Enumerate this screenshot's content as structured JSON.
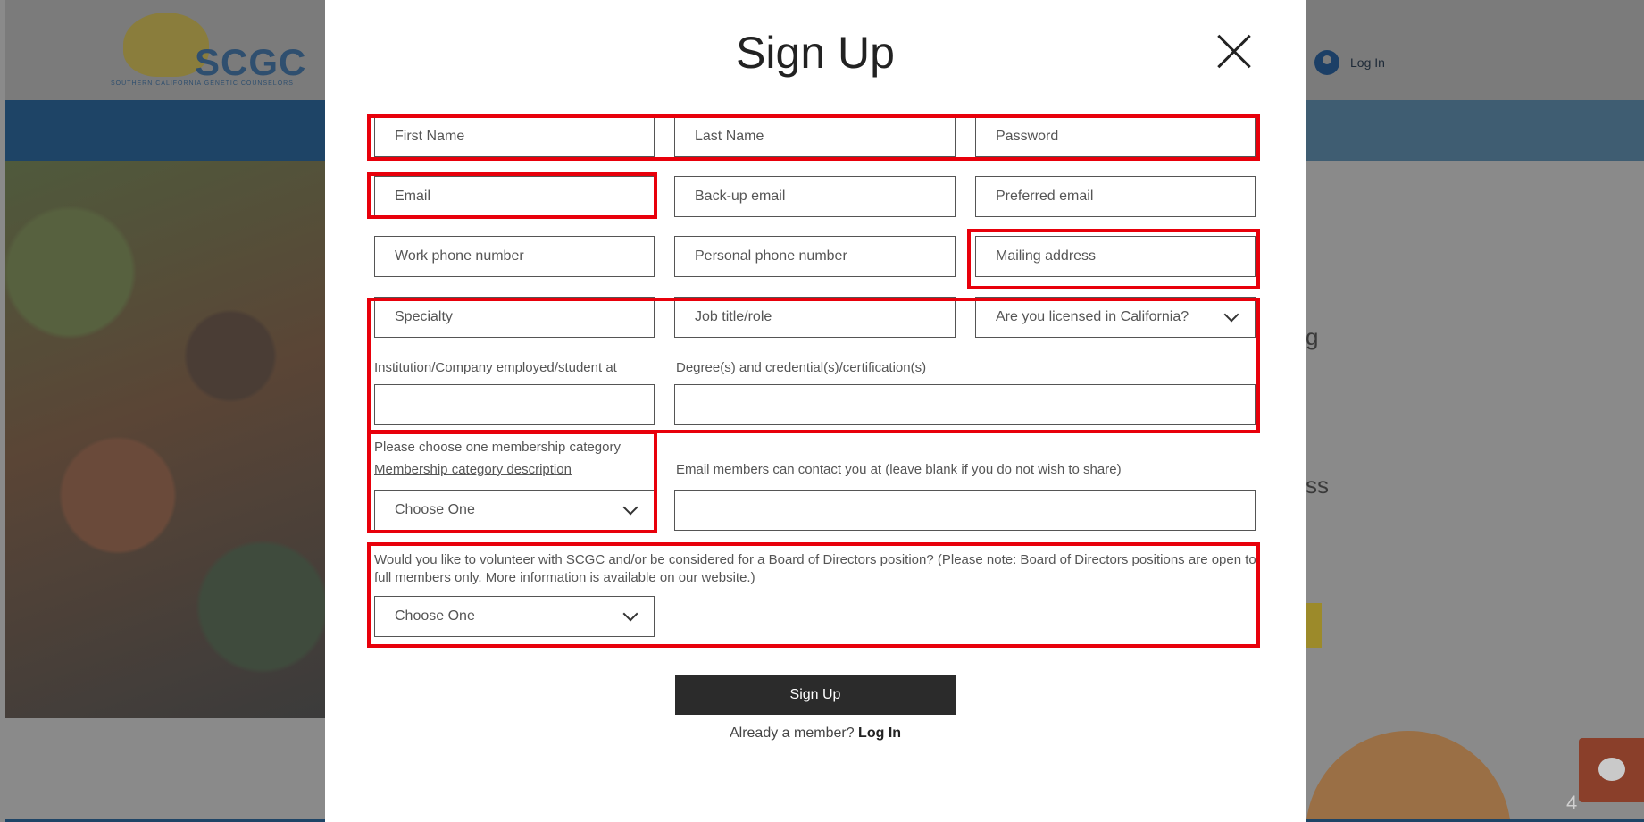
{
  "background": {
    "logo_text": "SCGC",
    "logo_subtitle": "SOUTHERN CALIFORNIA GENETIC COUNSELORS",
    "login_label": "Log In",
    "right_text_1": "g",
    "right_text_2": "ss",
    "page_number": "4"
  },
  "modal": {
    "title": "Sign Up",
    "fields": {
      "first_name": "First Name",
      "last_name": "Last Name",
      "password": "Password",
      "email": "Email",
      "backup_email": "Back-up email",
      "preferred_email": "Preferred email",
      "work_phone": "Work phone number",
      "personal_phone": "Personal phone number",
      "mailing_address": "Mailing address",
      "specialty": "Specialty",
      "job_title": "Job title/role"
    },
    "licensed_select": "Are you licensed in California?",
    "institution_label": "Institution/Company employed/student at",
    "degree_label": "Degree(s) and credential(s)/certification(s)",
    "membership_label": "Please choose one membership category",
    "membership_link": "Membership category description",
    "membership_select": "Choose One",
    "contact_email_label": "Email members can contact you at (leave blank if you do not wish to share)",
    "volunteer_label": "Would you like to volunteer with SCGC and/or be considered for a Board of Directors position? (Please note: Board of Directors positions are open to full members only. More information is available on our website.)",
    "volunteer_select": "Choose One",
    "submit_label": "Sign Up",
    "already_member": "Already a member?",
    "login_link": "Log In"
  },
  "colors": {
    "highlight": "#e8000b",
    "submit_bg": "#2b2b2b"
  }
}
